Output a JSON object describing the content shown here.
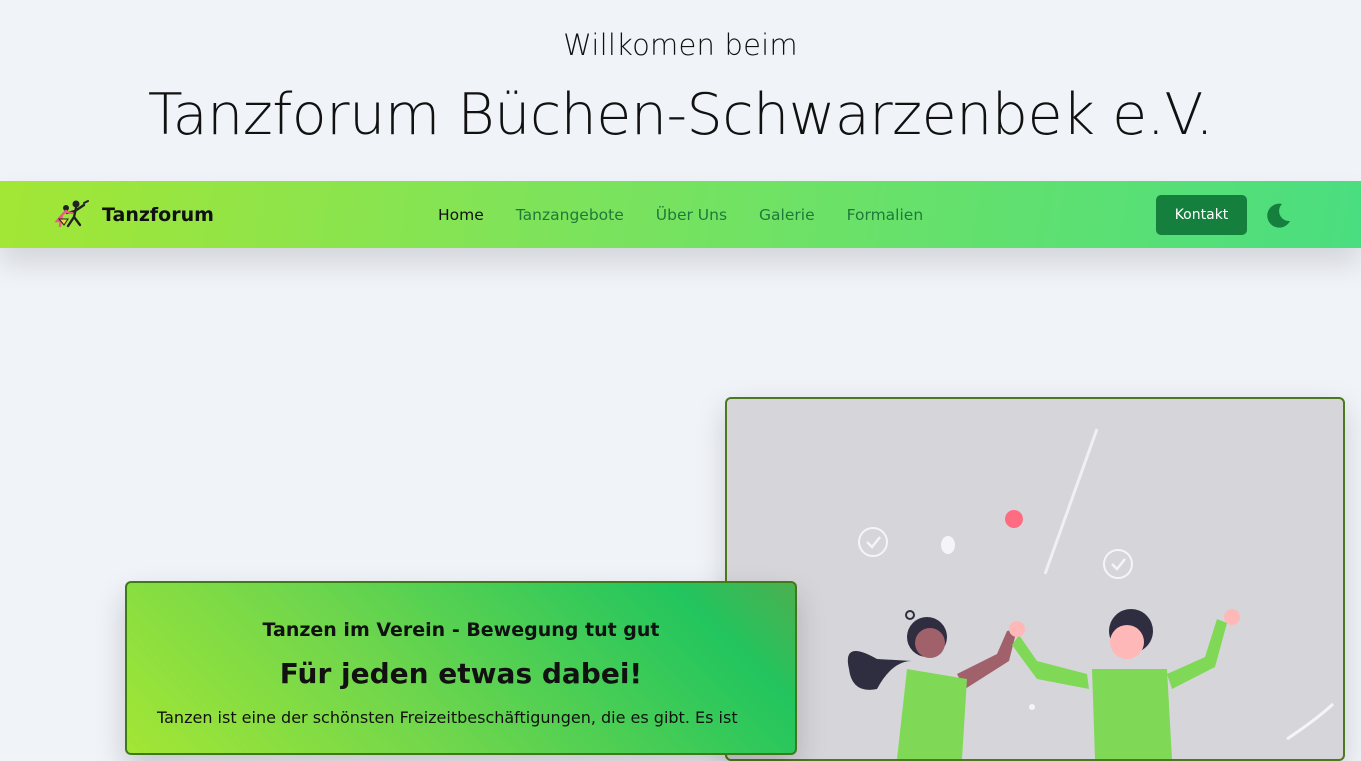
{
  "hero": {
    "subtitle": "Willkomen beim",
    "title": "Tanzforum Büchen-Schwarzenbek e.V."
  },
  "navbar": {
    "brand": "Tanzforum",
    "links": [
      {
        "label": "Home",
        "active": true
      },
      {
        "label": "Tanzangebote",
        "active": false
      },
      {
        "label": "Über Uns",
        "active": false
      },
      {
        "label": "Galerie",
        "active": false
      },
      {
        "label": "Formalien",
        "active": false
      }
    ],
    "contact_button": "Kontakt",
    "theme_toggle_icon": "moon-icon"
  },
  "feature": {
    "kicker": "Tanzen im Verein - Bewegung tut gut",
    "title": "Für jeden etwas dabei!",
    "text": "Tanzen ist eine der schönsten Freizeitbeschäftigungen, die es gibt. Es ist"
  },
  "colors": {
    "accent": "#15803d",
    "navbar_start": "#a3e635",
    "navbar_end": "#4ade80",
    "page_bg": "#f0f3f8"
  }
}
